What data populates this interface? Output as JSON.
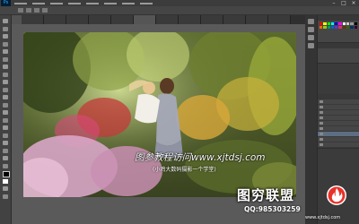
{
  "app": {
    "name": "Adobe Photoshop",
    "logo_text": "Ps"
  },
  "window_controls": [
    "–",
    "□",
    "×"
  ],
  "tabs": [
    {
      "label": "",
      "active": false
    },
    {
      "label": "",
      "active": false
    },
    {
      "label": "",
      "active": false
    },
    {
      "label": "",
      "active": false
    },
    {
      "label": "",
      "active": false
    },
    {
      "label": "",
      "active": true
    },
    {
      "label": "",
      "active": false
    },
    {
      "label": "",
      "active": false
    },
    {
      "label": "",
      "active": false
    },
    {
      "label": "",
      "active": false
    },
    {
      "label": "",
      "active": false
    },
    {
      "label": "",
      "active": false
    }
  ],
  "tools": [
    "move-tool",
    "marquee-tool",
    "lasso-tool",
    "quick-select-tool",
    "crop-tool",
    "eyedropper-tool",
    "healing-brush-tool",
    "brush-tool",
    "clone-stamp-tool",
    "history-brush-tool",
    "eraser-tool",
    "gradient-tool",
    "blur-tool",
    "dodge-tool",
    "pen-tool",
    "type-tool",
    "path-select-tool",
    "shape-tool",
    "hand-tool",
    "zoom-tool",
    "foreground-color",
    "background-color",
    "quick-mask",
    "screen-mode"
  ],
  "panels": {
    "swatch_colors": [
      "#ff0000",
      "#ffff00",
      "#00ff00",
      "#00ffff",
      "#0000ff",
      "#ff00ff",
      "#ffffff",
      "#cccccc",
      "#999999",
      "#000000",
      "#ff6600",
      "#99cc00",
      "#009966",
      "#0066cc",
      "#6633cc",
      "#cc3366",
      "#663300",
      "#336600",
      "#003366",
      "#330033"
    ],
    "layers": [
      {
        "name": "",
        "selected": false
      },
      {
        "name": "",
        "selected": false
      },
      {
        "name": "",
        "selected": false
      },
      {
        "name": "",
        "selected": false
      },
      {
        "name": "",
        "selected": false
      },
      {
        "name": "",
        "selected": false
      },
      {
        "name": "",
        "selected": true
      },
      {
        "name": "",
        "selected": false
      },
      {
        "name": "",
        "selected": false
      }
    ]
  },
  "canvas": {
    "watermark_url": "图参教程访问www.xjtdsj.com",
    "watermark_sub": "(小鸡大数码摄影一个学堂)"
  },
  "branding": {
    "title": "图穷联盟",
    "qq": "QQ:985303259",
    "site": "www.xjtdsj.com"
  },
  "colors": {
    "ui_dark": "#3c3c3c",
    "ui_panel": "#464646",
    "brand_orange": "#ff6a1a",
    "brand_red": "#e8322a"
  }
}
